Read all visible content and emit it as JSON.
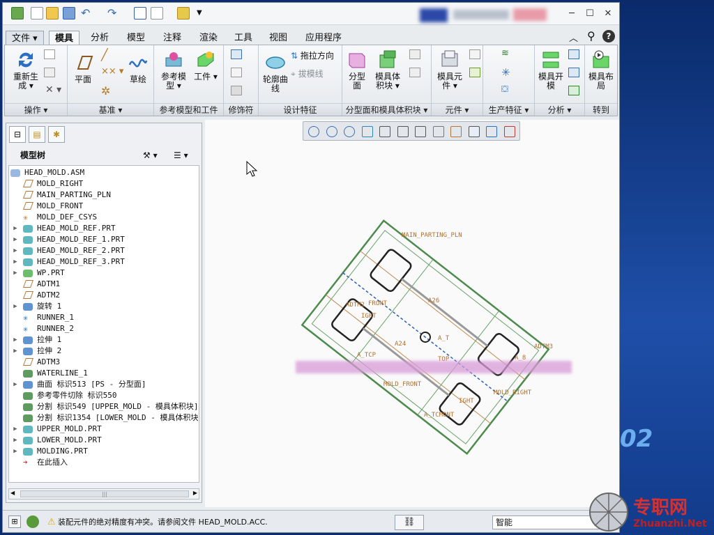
{
  "quick_access": [
    "app-logo-icon",
    "new-icon",
    "open-icon",
    "save-icon",
    "undo-icon",
    "redo-icon",
    "regenerate-icon",
    "windows-icon",
    "folder-icon",
    "customize-icon"
  ],
  "tabs": {
    "file": "文件",
    "model": "模具",
    "analysis": "分析",
    "modeling": "模型",
    "annotate": "注释",
    "render": "渲染",
    "tools": "工具",
    "view": "视图",
    "apps": "应用程序"
  },
  "ribbon": {
    "operations": {
      "label": "操作",
      "regen": "重新生成"
    },
    "datum": {
      "label": "基准",
      "plane": "平面",
      "sketch": "草绘"
    },
    "refmodel": {
      "label": "参考模型和工件",
      "ref": "参考模型",
      "workpiece": "工件"
    },
    "modifier": {
      "label": "修饰符"
    },
    "design": {
      "label": "设计特征",
      "profile": "轮廓曲线",
      "drag_dir": "拖拉方向",
      "draft_line": "拔模线"
    },
    "parting": {
      "label": "分型面和模具体积块",
      "parting_surf": "分型面",
      "mold_volume": "模具体积块"
    },
    "component": {
      "label": "元件",
      "mold_comp": "模具元件"
    },
    "production": {
      "label": "生产特征"
    },
    "analysis": {
      "label": "分析",
      "mold_open": "模具开模"
    },
    "goto": {
      "label": "转到",
      "mold_layout": "模具布局"
    }
  },
  "panel": {
    "title": "模型树"
  },
  "tree": [
    {
      "label": "HEAD_MOLD.ASM",
      "icon": "assembly",
      "level": 0,
      "exp": false
    },
    {
      "label": "MOLD_RIGHT",
      "icon": "datum-plane",
      "level": 1,
      "exp": false
    },
    {
      "label": "MAIN_PARTING_PLN",
      "icon": "datum-plane",
      "level": 1,
      "exp": false
    },
    {
      "label": "MOLD_FRONT",
      "icon": "datum-plane",
      "level": 1,
      "exp": false
    },
    {
      "label": "MOLD_DEF_CSYS",
      "icon": "csys",
      "level": 1,
      "exp": false
    },
    {
      "label": "HEAD_MOLD_REF.PRT",
      "icon": "ref-part",
      "level": 1,
      "exp": true
    },
    {
      "label": "HEAD_MOLD_REF_1.PRT",
      "icon": "ref-part",
      "level": 1,
      "exp": true
    },
    {
      "label": "HEAD_MOLD_REF_2.PRT",
      "icon": "ref-part",
      "level": 1,
      "exp": true
    },
    {
      "label": "HEAD_MOLD_REF_3.PRT",
      "icon": "ref-part",
      "level": 1,
      "exp": true
    },
    {
      "label": "WP.PRT",
      "icon": "workpiece",
      "level": 1,
      "exp": true
    },
    {
      "label": "ADTM1",
      "icon": "datum-plane",
      "level": 1,
      "exp": false
    },
    {
      "label": "ADTM2",
      "icon": "datum-plane",
      "level": 1,
      "exp": false
    },
    {
      "label": "旋转 1",
      "icon": "revolve",
      "level": 1,
      "exp": true
    },
    {
      "label": "RUNNER_1",
      "icon": "runner",
      "level": 1,
      "exp": false
    },
    {
      "label": "RUNNER_2",
      "icon": "runner",
      "level": 1,
      "exp": false
    },
    {
      "label": "拉伸 1",
      "icon": "extrude",
      "level": 1,
      "exp": true
    },
    {
      "label": "拉伸 2",
      "icon": "extrude",
      "level": 1,
      "exp": true
    },
    {
      "label": "ADTM3",
      "icon": "datum-plane",
      "level": 1,
      "exp": false
    },
    {
      "label": "WATERLINE_1",
      "icon": "waterline",
      "level": 1,
      "exp": false
    },
    {
      "label": "曲面 标识513 [PS - 分型面]",
      "icon": "surface",
      "level": 1,
      "exp": true
    },
    {
      "label": "参考零件切除 标识550",
      "icon": "cutout",
      "level": 1,
      "exp": false
    },
    {
      "label": "分割 标识549 [UPPER_MOLD - 模具体积块]",
      "icon": "split",
      "level": 1,
      "exp": false
    },
    {
      "label": "分割 标识1354 [LOWER_MOLD - 模具体积块]",
      "icon": "split",
      "level": 1,
      "exp": false
    },
    {
      "label": "UPPER_MOLD.PRT",
      "icon": "mold-part",
      "level": 1,
      "exp": true
    },
    {
      "label": "LOWER_MOLD.PRT",
      "icon": "mold-part",
      "level": 1,
      "exp": true
    },
    {
      "label": "MOLDING.PRT",
      "icon": "molding",
      "level": 1,
      "exp": true
    },
    {
      "label": "在此插入",
      "icon": "insert-arrow",
      "level": 1,
      "exp": false
    }
  ],
  "graphics_toolbar": [
    "refit-icon",
    "zoom-in-icon",
    "zoom-out-icon",
    "repaint-icon",
    "orient-icon",
    "saved-views-icon",
    "display-style-icon",
    "annotation-display-icon",
    "datum-display-icon",
    "spin-center-icon",
    "section-icon",
    "named-views-icon"
  ],
  "model_labels": [
    "MAIN_PARTING_PLN",
    "ADTM2",
    "FRONT",
    "ADTM3",
    "MOLD_FRONT",
    "MOLD_RIGHT",
    "IGHT",
    "A26",
    "A24",
    "A_8",
    "A_T",
    "A_TCP",
    "TOP",
    "A_TCMONT",
    "IGHT"
  ],
  "status": {
    "message": "装配元件的绝对精度有冲突。请参阅文件 HEAD_MOLD.ACC.",
    "filter": "智能"
  },
  "watermark": {
    "cn": "专职网",
    "en": "Zhuanzhi.Net"
  },
  "colors": {
    "accent": "#1f5fb5",
    "title_blur": "#3050a8",
    "status_warning": "#e0a800"
  }
}
